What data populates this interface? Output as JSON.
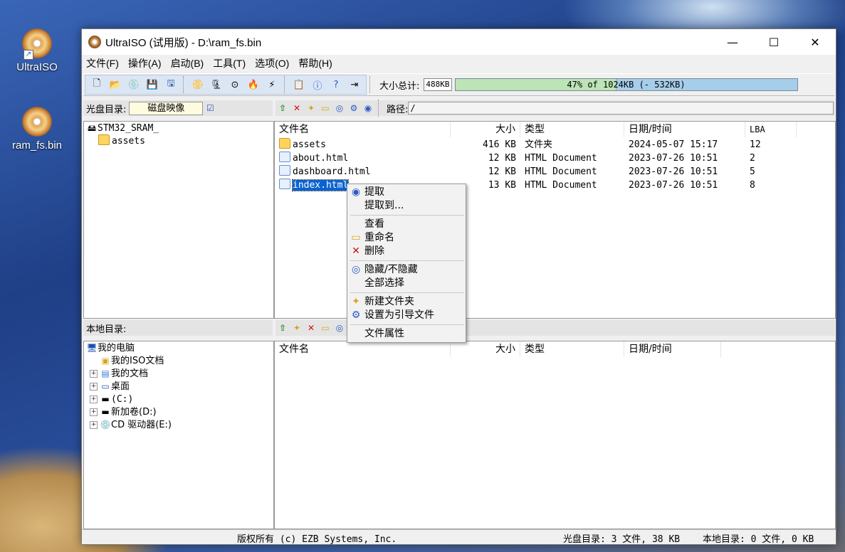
{
  "desktop": {
    "icons": [
      {
        "label": "UltraISO"
      },
      {
        "label": "ram_fs.bin"
      }
    ]
  },
  "window": {
    "title": "UltraISO (试用版) - D:\\ram_fs.bin",
    "minimize": "—",
    "maximize": "☐",
    "close": "✕"
  },
  "menu": [
    "文件(F)",
    "操作(A)",
    "启动(B)",
    "工具(T)",
    "选项(O)",
    "帮助(H)"
  ],
  "toolbar": {
    "size_label": "大小总计:",
    "size_value": "488KB",
    "progress_text": "47% of 1024KB (- 532KB)",
    "progress_fraction": 0.47
  },
  "iso_bar": {
    "label": "光盘目录:",
    "volume_field": "磁盘映像",
    "path_label": "路径:",
    "path_value": "/"
  },
  "iso_tree": {
    "root": "STM32_SRAM_",
    "children": [
      "assets"
    ]
  },
  "iso_list": {
    "headers": [
      "文件名",
      "大小",
      "类型",
      "日期/时间",
      "LBA"
    ],
    "rows": [
      {
        "name": "assets",
        "size": "416 KB",
        "type": "文件夹",
        "date": "2024-05-07 15:17",
        "lba": "12",
        "icon": "folder-icon"
      },
      {
        "name": "about.html",
        "size": "12 KB",
        "type": "HTML Document",
        "date": "2023-07-26 10:51",
        "lba": "2",
        "icon": "html-file-icon"
      },
      {
        "name": "dashboard.html",
        "size": "12 KB",
        "type": "HTML Document",
        "date": "2023-07-26 10:51",
        "lba": "5",
        "icon": "html-file-icon"
      },
      {
        "name": "index.html",
        "size": "13 KB",
        "type": "HTML Document",
        "date": "2023-07-26 10:51",
        "lba": "8",
        "icon": "html-file-icon"
      }
    ]
  },
  "local_bar": {
    "label": "本地目录:"
  },
  "local_tree": {
    "root": "我的电脑",
    "items": [
      "我的ISO文档",
      "我的文档",
      "桌面",
      "(C:)",
      "新加卷(D:)",
      "CD 驱动器(E:)"
    ]
  },
  "local_list": {
    "headers": [
      "文件名",
      "大小",
      "类型",
      "日期/时间"
    ]
  },
  "context_menu": {
    "extract": "提取",
    "extract_to": "提取到...",
    "view": "查看",
    "rename": "重命名",
    "delete": "删除",
    "hide_unhide": "隐藏/不隐藏",
    "select_all": "全部选择",
    "new_folder": "新建文件夹",
    "set_boot_file": "设置为引导文件",
    "properties": "文件属性"
  },
  "status": {
    "copyright": "版权所有 (c) EZB Systems, Inc.",
    "iso_info": "光盘目录: 3 文件, 38 KB",
    "local_info": "本地目录: 0 文件, 0 KB"
  }
}
